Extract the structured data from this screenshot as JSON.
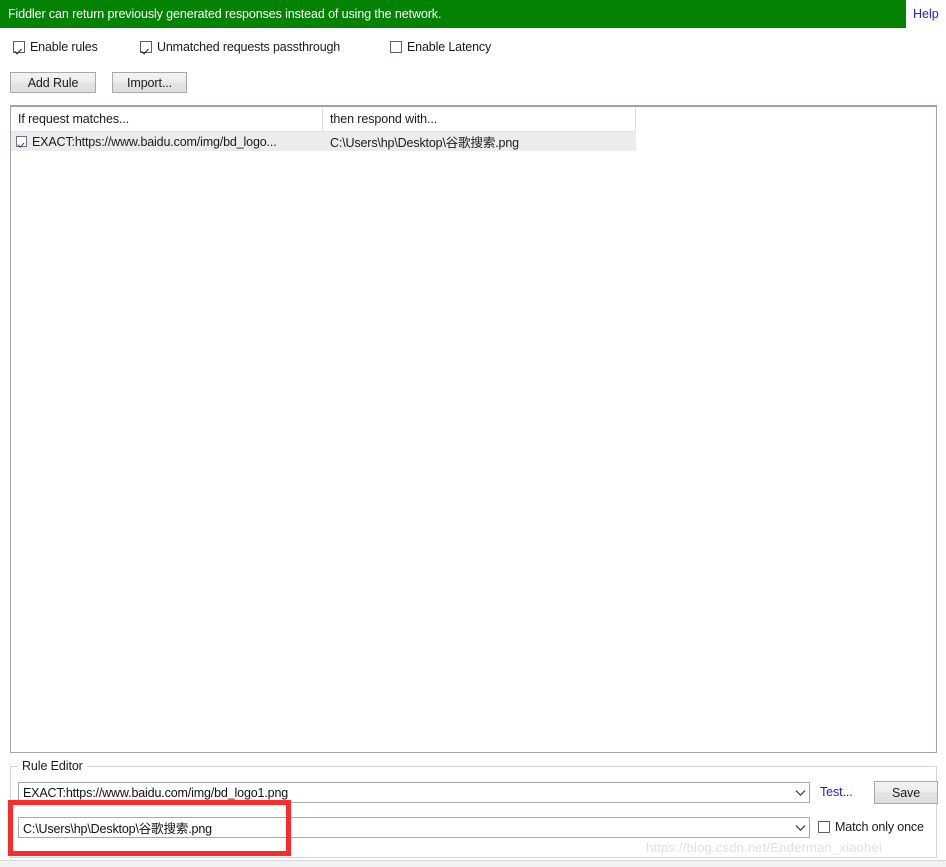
{
  "banner": {
    "message": "Fiddler can return previously generated responses instead of using the network.",
    "help_label": "Help",
    "background_color": "#038203",
    "link_color": "#2121d6"
  },
  "options": {
    "checkboxes": [
      {
        "label": "Enable rules",
        "checked": true
      },
      {
        "label": "Unmatched requests passthrough",
        "checked": true
      },
      {
        "label": "Enable Latency",
        "checked": false
      }
    ]
  },
  "toolbar": {
    "add_rule_label": "Add Rule",
    "import_label": "Import..."
  },
  "rule_list": {
    "columns": [
      "If request matches...",
      "then respond with..."
    ],
    "rows": [
      {
        "enabled": true,
        "match": "EXACT:https://www.baidu.com/img/bd_logo...",
        "respond": "C:\\Users\\hp\\Desktop\\谷歌搜索.png",
        "selected": true
      }
    ]
  },
  "rule_editor": {
    "legend": "Rule Editor",
    "match_value": "EXACT:https://www.baidu.com/img/bd_logo1.png",
    "respond_value": "C:\\Users\\hp\\Desktop\\谷歌搜索.png",
    "test_label": "Test...",
    "save_label": "Save",
    "match_only_once_label": "Match only once",
    "match_only_once_checked": false
  },
  "annotation": {
    "highlight_color": "#fa2b2b"
  },
  "watermark": {
    "text": "https://blog.csdn.net/Enderman_xiaohei"
  }
}
